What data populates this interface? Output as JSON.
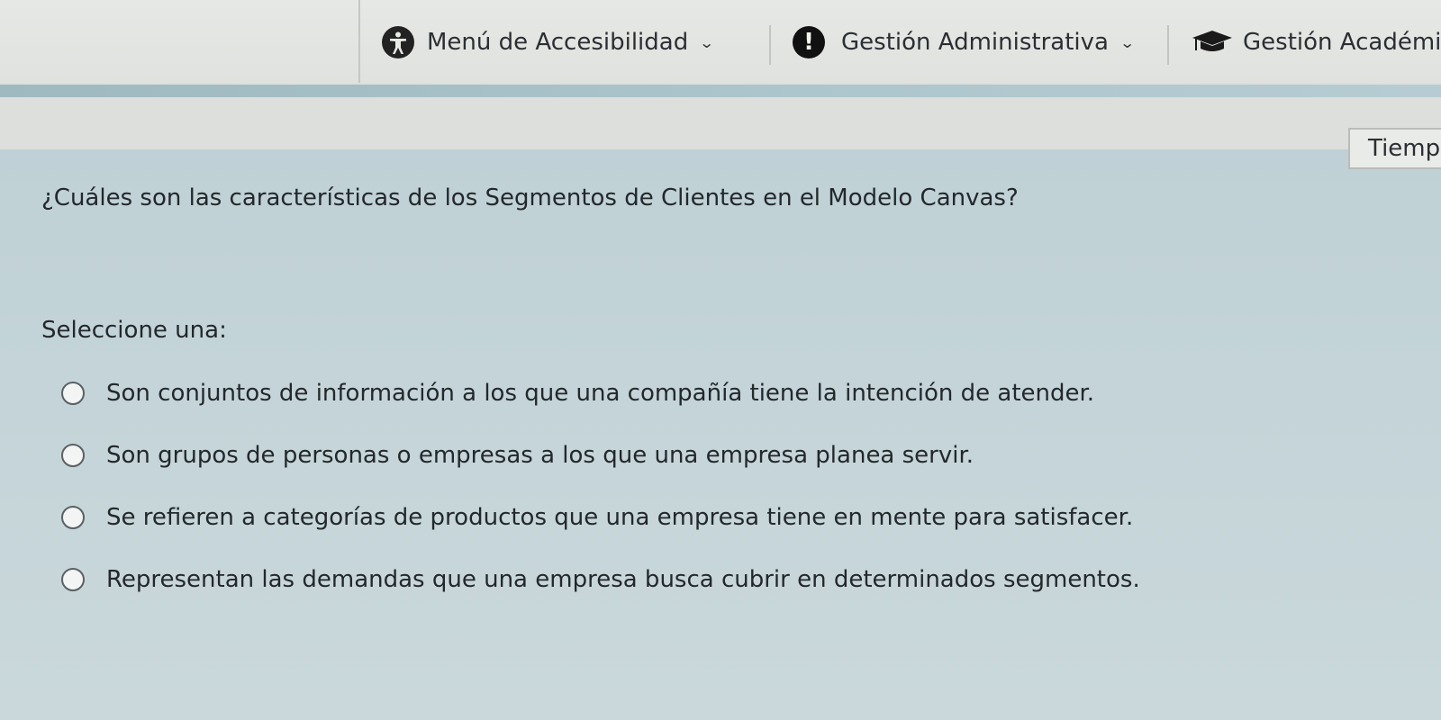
{
  "nav": {
    "items": [
      {
        "label": "Menú de Accesibilidad",
        "icon": "accessibility-icon"
      },
      {
        "label": "Gestión Administrativa",
        "icon": "alert-icon"
      },
      {
        "label": "Gestión Académi",
        "icon": "graduation-cap-icon"
      }
    ]
  },
  "timer": {
    "label": "Tiemp"
  },
  "quiz": {
    "question": "¿Cuáles son las características de los Segmentos de Clientes en el Modelo Canvas?",
    "prompt": "Seleccione una:",
    "options": [
      {
        "text": "Son conjuntos de información a los que una compañía tiene la intención de atender."
      },
      {
        "text": "Son grupos de personas o empresas a los que una empresa planea servir."
      },
      {
        "text": "Se refieren a categorías de productos que una empresa tiene en mente para satisfacer."
      },
      {
        "text": "Representan las demandas que una empresa busca cubrir en determinados segmentos."
      }
    ]
  },
  "colors": {
    "card_background": "#c4d4d8",
    "nav_background": "#e3e5e2",
    "accent_stripe": "#aec6cd"
  }
}
